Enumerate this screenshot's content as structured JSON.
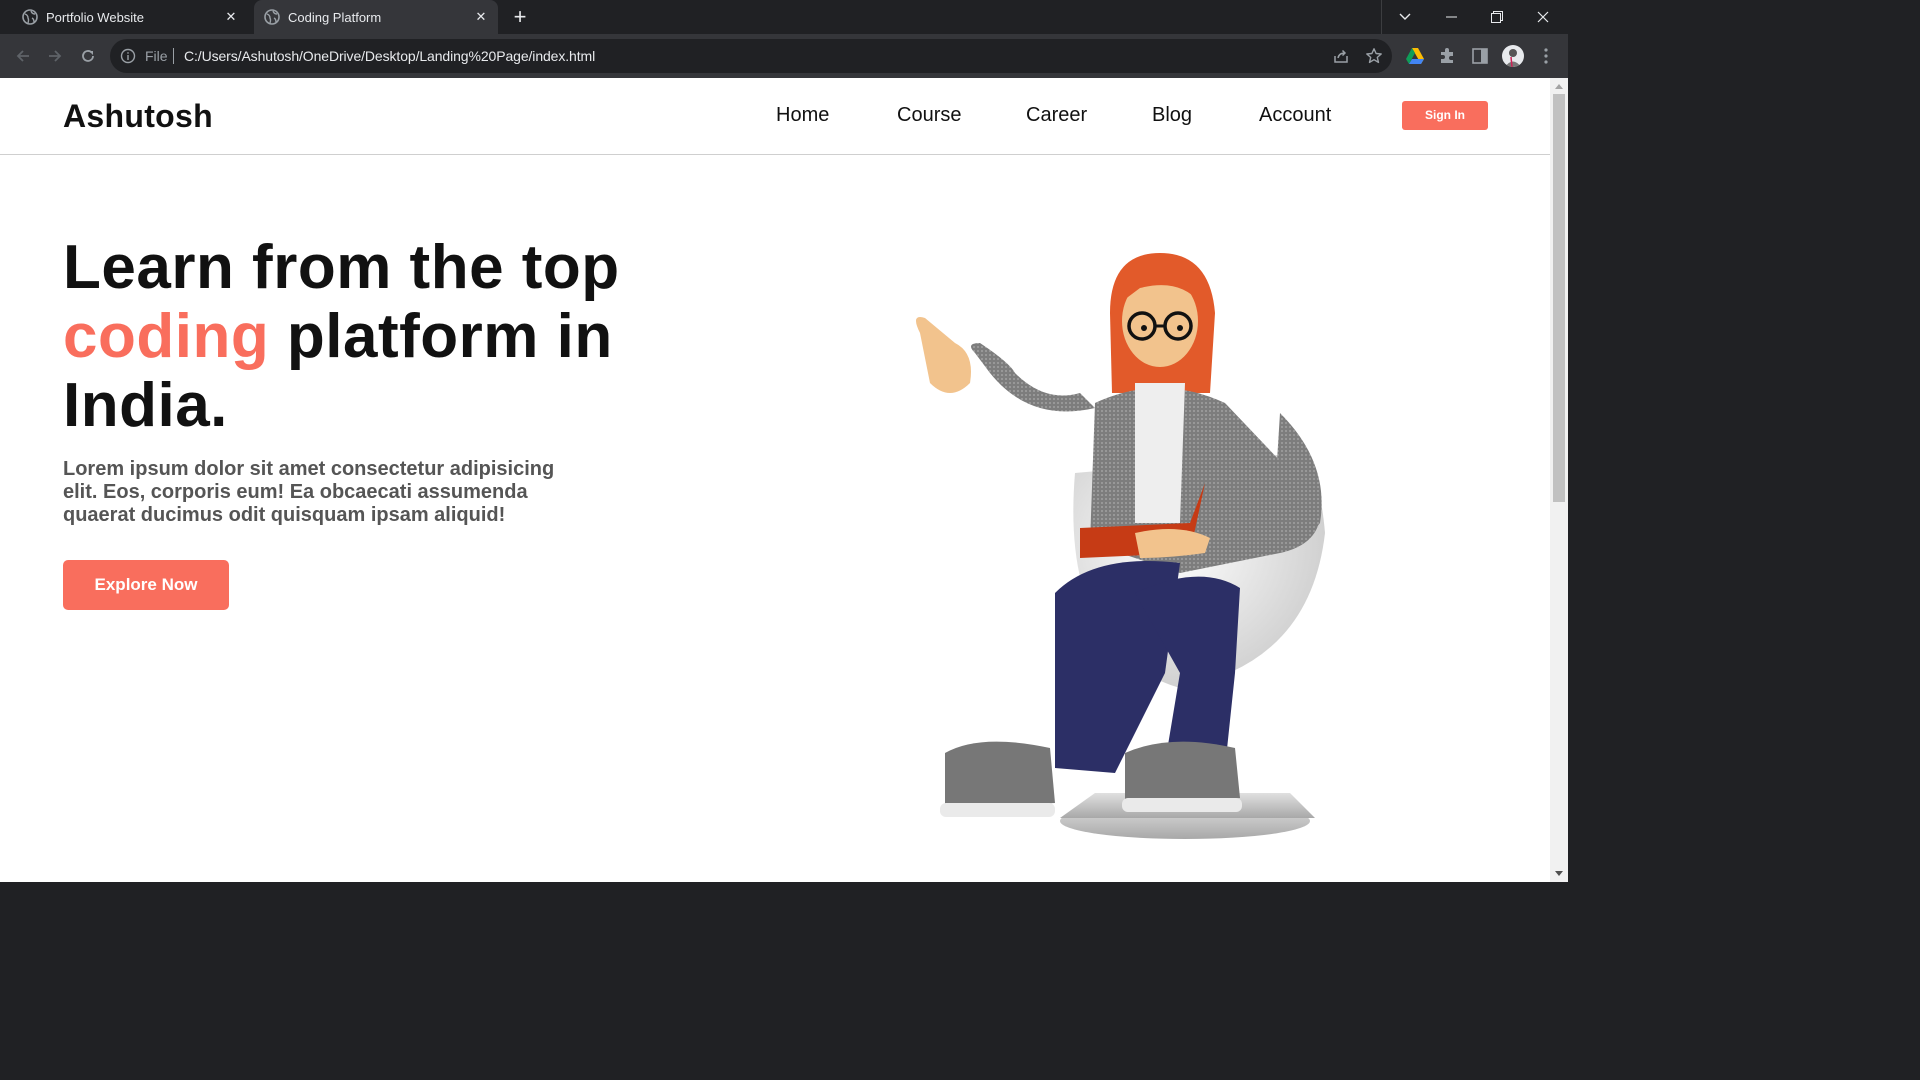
{
  "browser": {
    "tabs": [
      {
        "title": "Portfolio Website",
        "active": false
      },
      {
        "title": "Coding Platform",
        "active": true
      }
    ],
    "address_scheme": "File",
    "address_url": "C:/Users/Ashutosh/OneDrive/Desktop/Landing%20Page/index.html",
    "new_tab_symbol": "+",
    "close_symbol": "✕"
  },
  "header": {
    "logo": "Ashutosh",
    "nav": {
      "home": "Home",
      "course": "Course",
      "career": "Career",
      "blog": "Blog",
      "account": "Account"
    },
    "sign_in": "Sign In"
  },
  "hero": {
    "title_line1": "Learn from the top",
    "title_accent": "coding",
    "title_line2_rest": " platform in",
    "title_line3": "India.",
    "description": "Lorem ipsum dolor sit amet consectetur adipisicing elit. Eos, corporis eum! Ea obcaecati assumenda quaerat ducimus odit quisquam ipsam aliquid!",
    "cta": "Explore Now"
  },
  "colors": {
    "accent": "#f96e5d",
    "chrome_dark": "#202124",
    "chrome_toolbar": "#35363a",
    "text_dark": "#111111",
    "text_muted": "#555555"
  },
  "icons": [
    "globe-icon",
    "close-icon",
    "plus-icon",
    "chevron-down-icon",
    "minimize-icon",
    "restore-icon",
    "window-close-icon",
    "back-icon",
    "forward-icon",
    "reload-icon",
    "info-icon",
    "share-icon",
    "star-icon",
    "google-drive-icon",
    "puzzle-icon",
    "side-panel-icon",
    "kebab-menu-icon"
  ]
}
